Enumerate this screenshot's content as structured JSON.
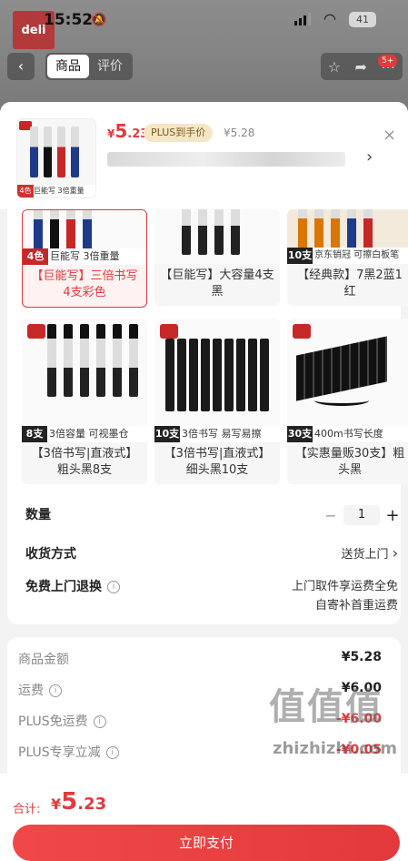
{
  "status_bar": {
    "time": "15:52",
    "battery": "41"
  },
  "nav": {
    "back_icon": "chevron-left-icon",
    "tabs": [
      {
        "label": "商品"
      },
      {
        "label": "评价"
      }
    ],
    "cart_badge": "5+",
    "brand": "deli"
  },
  "product": {
    "price_yen": "¥",
    "price_int": "5",
    "price_dec": ".23",
    "plus_badge": "PLUS到手价",
    "original_price": "¥5.28",
    "thumb_tag": "4色",
    "thumb_desc": "巨能写 3倍重量"
  },
  "variants": [
    {
      "name": "【巨能写】三倍书写4支彩色",
      "tag": "4色",
      "strip": "巨能写 3倍重量",
      "selected": true
    },
    {
      "name": "【巨能写】大容量4支黑",
      "tag": "",
      "strip": "",
      "selected": false
    },
    {
      "name": "【经典款】7黑2蓝1红",
      "tag": "10支",
      "strip": "京东销冠 可擦白板笔",
      "selected": false
    },
    {
      "name": "【3倍书写|直液式】粗头黑8支",
      "tag": "8支",
      "strip": "3倍容量 可视墨仓",
      "selected": false
    },
    {
      "name": "【3倍书写|直液式】细头黑10支",
      "tag": "10支",
      "strip": "3倍书写 易写易擦",
      "selected": false
    },
    {
      "name": "【实惠量贩30支】粗头黑",
      "tag": "30支",
      "strip": "400m书写长度",
      "selected": false
    }
  ],
  "options": {
    "quantity_label": "数量",
    "quantity": "1",
    "minus": "−",
    "plus": "+",
    "delivery_label": "收货方式",
    "delivery_value": "送货上门",
    "return_label": "免费上门退换",
    "return_line1": "上门取件享运费全免",
    "return_line2": "自寄补首重运费"
  },
  "fees": [
    {
      "label": "商品金额",
      "amount": "¥5.28",
      "info": false,
      "red": false
    },
    {
      "label": "运费",
      "amount": "¥6.00",
      "info": true,
      "red": false
    },
    {
      "label": "PLUS免运费",
      "amount": "-¥6.00",
      "info": true,
      "red": true
    },
    {
      "label": "PLUS专享立减",
      "amount": "-¥0.05",
      "info": true,
      "red": true
    }
  ],
  "checkout": {
    "total_label": "合计:",
    "total_yen": "¥",
    "total_int": "5",
    "total_dec": ".23",
    "pay_button": "立即支付"
  },
  "watermark": {
    "logo": "值值值",
    "url": "zhizhizhi.com"
  },
  "colors": {
    "accent": "#e4393c",
    "plus_gold": "#f5e6c6"
  }
}
